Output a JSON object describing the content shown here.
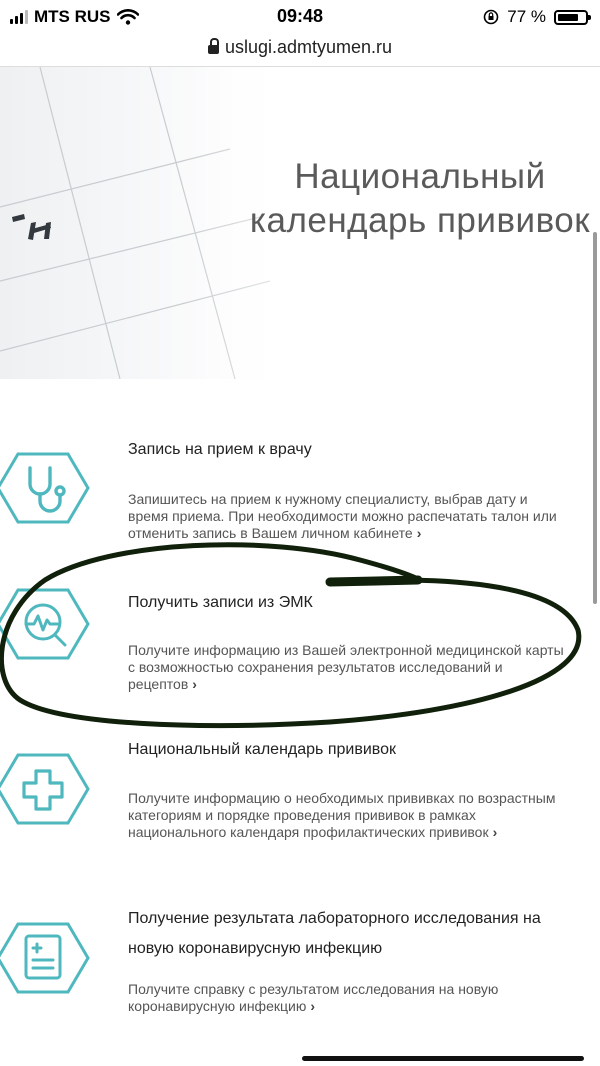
{
  "status_bar": {
    "carrier": "MTS RUS",
    "time": "09:48",
    "battery": "77 %",
    "battery_level": 0.77
  },
  "browser": {
    "url": "uslugi.admtyumen.ru"
  },
  "hero": {
    "title_line1": "Национальный",
    "title_line2": "календарь прививок"
  },
  "services": [
    {
      "title": "Запись на прием к врачу",
      "description": "Запишитесь на прием к нужному специалисту, выбрав дату и время приема. При необходимости можно распечатать талон или отменить запись в Вашем личном кабинете",
      "icon": "stethoscope-icon"
    },
    {
      "title": "Получить записи из ЭМК",
      "description": "Получите информацию из Вашей электронной медицинской карты с возможностью сохранения результатов исследований и рецептов",
      "icon": "heartbeat-magnifier-icon"
    },
    {
      "title": "Национальный календарь прививок",
      "description": "Получите информацию о необходимых прививках по возрастным категориям и порядке проведения прививок в рамках национального календаря профилактических прививок",
      "icon": "medical-cross-icon"
    },
    {
      "title": "Получение результата лабораторного исследования на новую коронавирусную инфекцию",
      "description": "Получите справку с результатом исследования на новую коронавирусную инфекцию",
      "icon": "lab-report-icon"
    }
  ],
  "link_chevron": "›",
  "colors": {
    "icon_accent": "#4fb8bf",
    "annotation": "#10200a"
  }
}
